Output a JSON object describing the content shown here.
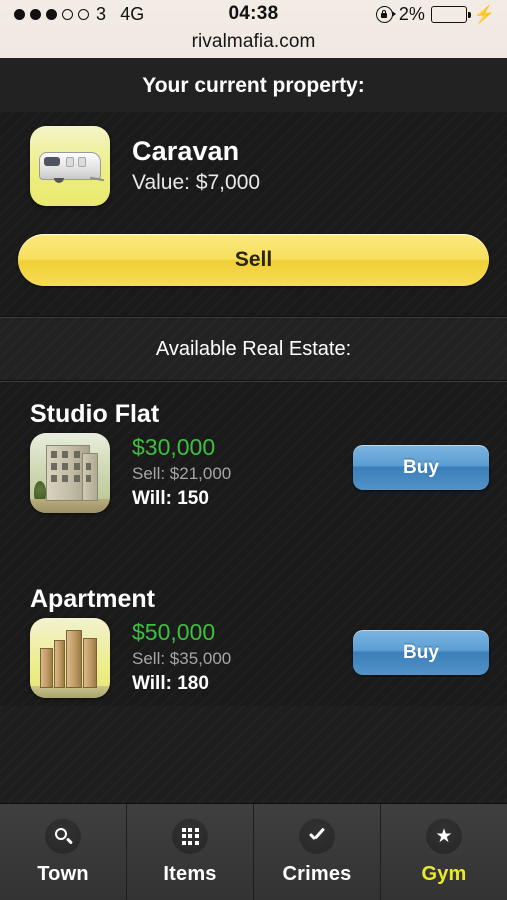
{
  "statusbar": {
    "signal_dots_filled": 3,
    "signal_dots_total": 5,
    "carrier": "3",
    "network": "4G",
    "time": "04:38",
    "battery_percent": "2%",
    "rotation_lock_icon": "rotation-lock-icon",
    "charging_icon": "lightning-bolt-icon",
    "url": "rivalmafia.com"
  },
  "current_property_section": {
    "title": "Your current property:",
    "property": {
      "name": "Caravan",
      "value_label": "Value: $7,000",
      "icon": "caravan-icon"
    },
    "sell_label": "Sell"
  },
  "available_section": {
    "title": "Available Real Estate:",
    "listings": [
      {
        "name": "Studio Flat",
        "price": "$30,000",
        "sell_price": "Sell: $21,000",
        "will": "Will: 150",
        "buy_label": "Buy",
        "icon": "studio-flat-icon"
      },
      {
        "name": "Apartment",
        "price": "$50,000",
        "sell_price": "Sell: $35,000",
        "will": "Will: 180",
        "buy_label": "Buy",
        "icon": "apartment-icon"
      }
    ]
  },
  "tabbar": {
    "tabs": [
      {
        "label": "Town",
        "icon": "search-icon",
        "active": false
      },
      {
        "label": "Items",
        "icon": "grid-icon",
        "active": false
      },
      {
        "label": "Crimes",
        "icon": "check-icon",
        "active": false
      },
      {
        "label": "Gym",
        "icon": "star-icon",
        "active": true
      }
    ]
  },
  "colors": {
    "accent_yellow": "#eaea2b",
    "price_green": "#3fbf3f",
    "buy_blue": "#5b9fd4",
    "sell_yellow": "#f7df5c",
    "background": "#1e1e1e"
  }
}
